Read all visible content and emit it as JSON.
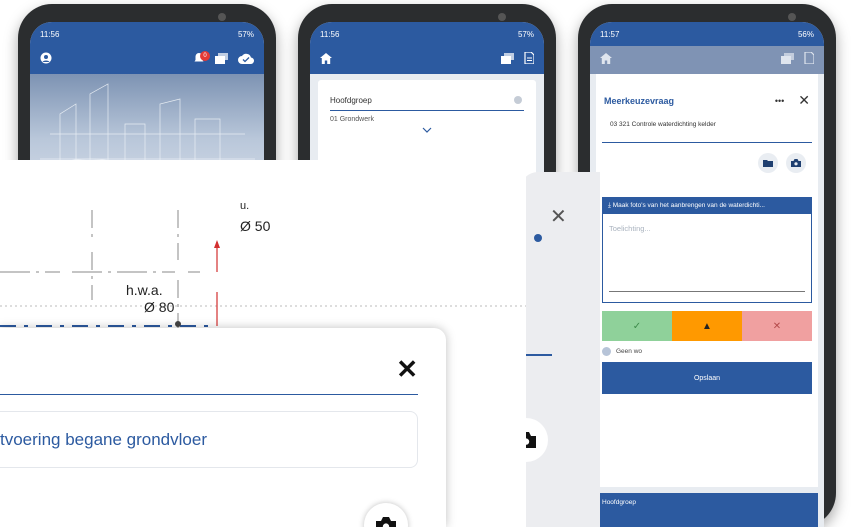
{
  "phone1": {
    "time": "11:56",
    "status_right": "57%",
    "notification_count": "0"
  },
  "phone2": {
    "time": "11:56",
    "status_right": "57%",
    "card": {
      "label": "Hoofdgroep",
      "value": "01 Grondwerk"
    }
  },
  "phone3": {
    "time": "11:57",
    "status_right": "56%",
    "title": "Meerkeuzevraag",
    "more": "•••",
    "close": "✕",
    "code": "03 321 Controle waterdichting kelder",
    "photo_bar": "Maak foto's van het aanbrengen van de waterdichti...",
    "textarea_placeholder": "Toelichting...",
    "choices": [
      "✓",
      "▲",
      "✕"
    ],
    "choice_colors": [
      "#8fd19a",
      "#ff9900",
      "#f0a0a0"
    ],
    "geen": "Geen wo",
    "save": "Opslaan",
    "footer": "Hoofdgroep"
  },
  "middle": {
    "close": "✕"
  },
  "drawing": {
    "label_top_small": "u.",
    "label_top": "Ø 50",
    "label_hwa": "h.w.a.",
    "label_hwa_d": "Ø 80"
  },
  "dialog": {
    "close": "✕",
    "field_value": "tvoering begane grondvloer"
  },
  "colors": {
    "primary": "#2c5aa0"
  }
}
